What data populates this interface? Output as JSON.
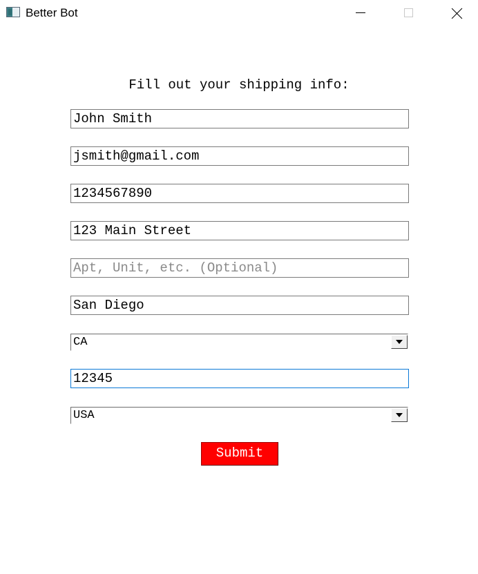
{
  "window": {
    "title": "Better Bot",
    "app_icon": "app-icon",
    "controls": {
      "minimize_icon": "minimize-icon",
      "maximize_icon": "maximize-icon",
      "close_icon": "close-icon"
    }
  },
  "form": {
    "heading": "Fill out your shipping info:",
    "fields": {
      "name": {
        "value": "John Smith",
        "placeholder": ""
      },
      "email": {
        "value": "jsmith@gmail.com",
        "placeholder": ""
      },
      "phone": {
        "value": "1234567890",
        "placeholder": ""
      },
      "address1": {
        "value": "123 Main Street",
        "placeholder": ""
      },
      "address2": {
        "value": "",
        "placeholder": "Apt, Unit, etc. (Optional)"
      },
      "city": {
        "value": "San Diego",
        "placeholder": ""
      },
      "zip": {
        "value": "12345",
        "placeholder": ""
      }
    },
    "state_select": {
      "selected": "CA"
    },
    "country_select": {
      "selected": "USA"
    },
    "submit_label": "Submit"
  },
  "colors": {
    "submit_background": "#ff0000",
    "submit_text": "#ffffff",
    "focus_border": "#0a78d7"
  }
}
